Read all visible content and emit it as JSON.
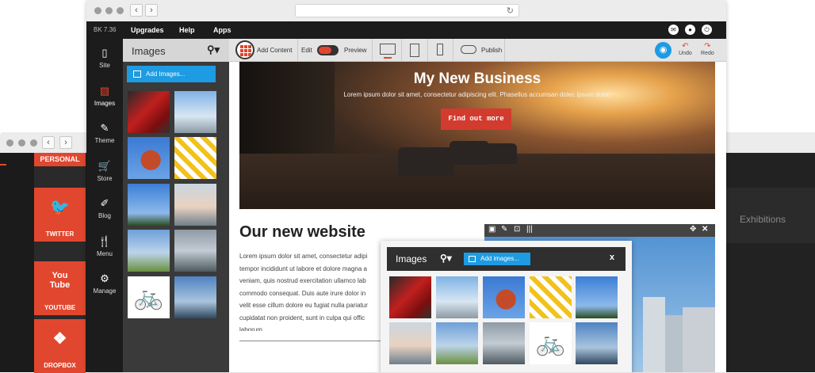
{
  "back_left": {
    "personal_label": "PERSONAL",
    "tiles": [
      {
        "label": "TWITTER",
        "glyph": "🐦",
        "icon": "twitter-icon"
      },
      {
        "label": "YOUTUBE",
        "glyph": "You Tube",
        "icon": "youtube-icon"
      },
      {
        "label": "DROPBOX",
        "glyph": "❖",
        "icon": "dropbox-icon"
      }
    ]
  },
  "back_right": {
    "text": "Exhibitions"
  },
  "menubar": {
    "version": "BK 7.36",
    "items": [
      "Upgrades",
      "Help",
      "Apps"
    ]
  },
  "sidebar": {
    "items": [
      {
        "label": "Site",
        "glyph": "▯"
      },
      {
        "label": "Images",
        "glyph": "▨"
      },
      {
        "label": "Theme",
        "glyph": "✎"
      },
      {
        "label": "Store",
        "glyph": "🛒"
      },
      {
        "label": "Blog",
        "glyph": "✐"
      },
      {
        "label": "Menu",
        "glyph": "🍴"
      },
      {
        "label": "Manage",
        "glyph": "⚙"
      }
    ]
  },
  "panel": {
    "title": "Images",
    "add_label": "Add Images..."
  },
  "toolbar": {
    "add_content": "Add Content",
    "edit": "Edit",
    "preview": "Preview",
    "publish": "Publish",
    "undo": "Undo",
    "redo": "Redo"
  },
  "hero": {
    "title": "My New Business",
    "subtitle": "Lorem ipsum dolor sit amet, consectetur adipiscing elit. Phasellus accumsan dolec ipsum dolor.",
    "button": "Find out more"
  },
  "section": {
    "title": "Our new website",
    "body": "Lorem ipsum dolor sit amet, consectetur adipi\ntempor incididunt ut labore et dolore magna a\nveniam, quis nostrud exercitation ullamco lab\ncommodo consequat. Duis aute irure dolor in\nvelit esse cillum dolore eu fugiat nulla pariatur\ncupidatat non proident, sunt in culpa qui offic\nlaborum."
  },
  "popup": {
    "title": "Images",
    "add_label": "Add images...",
    "close": "x"
  },
  "colors": {
    "accent_red": "#e1472f",
    "accent_blue": "#1d9be3",
    "chrome_dark": "#1c1c1c"
  }
}
